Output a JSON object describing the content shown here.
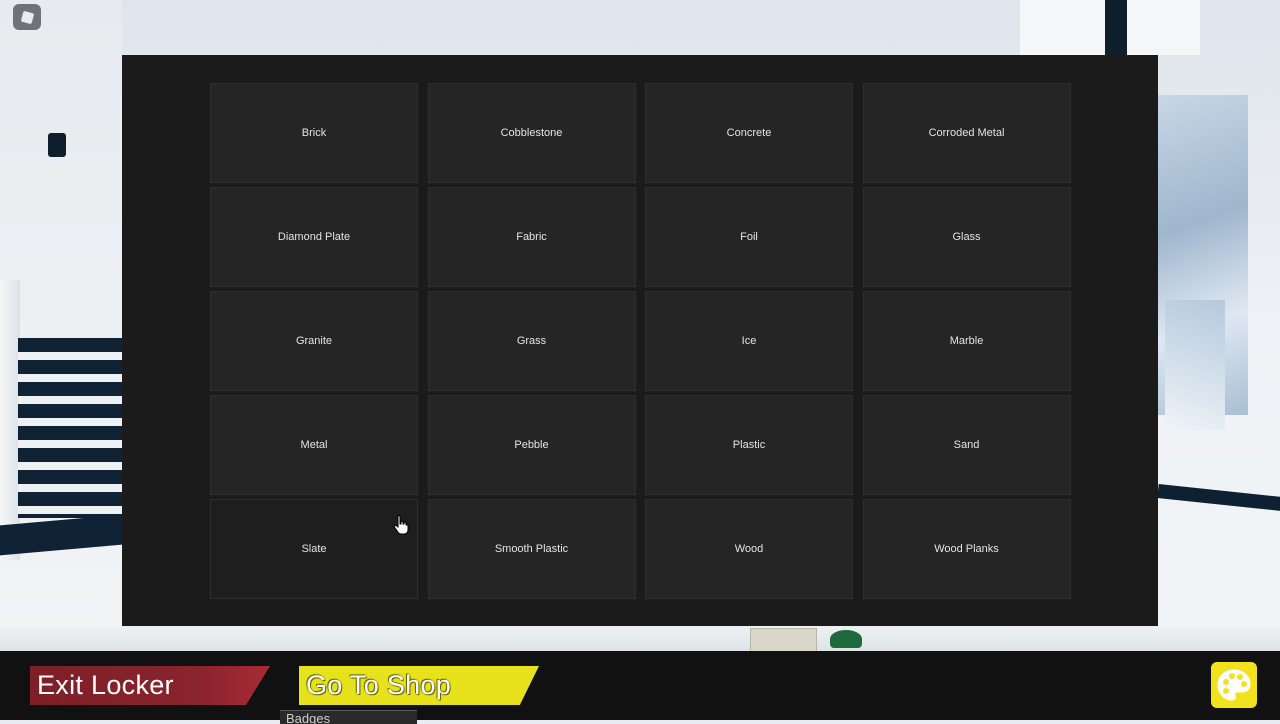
{
  "materials": [
    [
      "Brick",
      "Cobblestone",
      "Concrete",
      "Corroded Metal"
    ],
    [
      "Diamond Plate",
      "Fabric",
      "Foil",
      "Glass"
    ],
    [
      "Granite",
      "Grass",
      "Ice",
      "Marble"
    ],
    [
      "Metal",
      "Pebble",
      "Plastic",
      "Sand"
    ],
    [
      "Slate",
      "Smooth Plastic",
      "Wood",
      "Wood Planks"
    ]
  ],
  "bottom_bar": {
    "exit_label": "Exit Locker",
    "shop_label": "Go To Shop",
    "badges_label": "Badges"
  },
  "icons": {
    "roblox_menu": "roblox-logo-icon",
    "paint": "palette-icon"
  },
  "colors": {
    "exit_button": "#8a242d",
    "shop_button": "#e8e21c",
    "paint_button": "#f2e21d",
    "panel": "#1b1b1b"
  }
}
